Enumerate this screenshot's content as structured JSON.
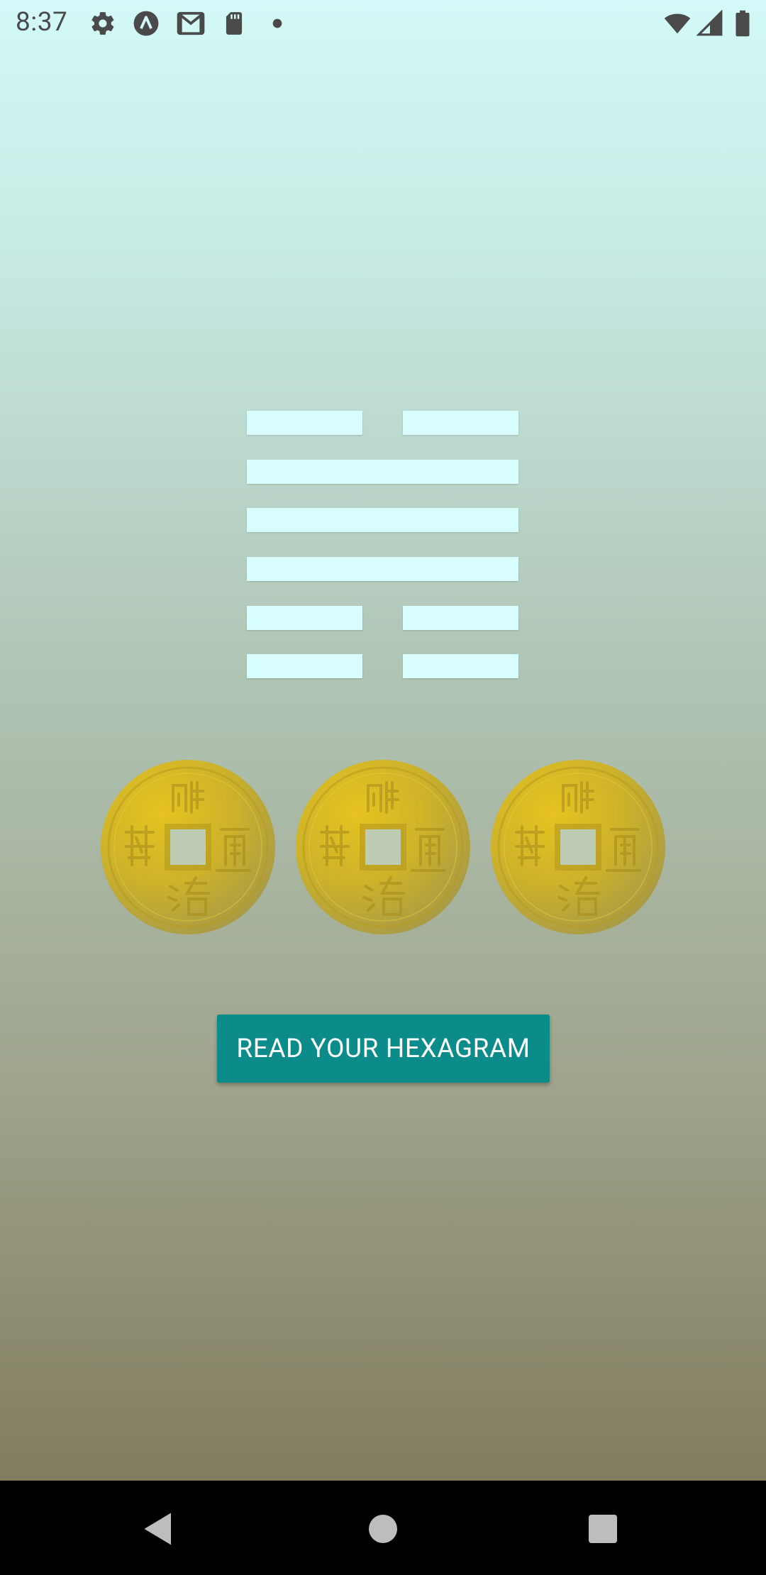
{
  "status_bar": {
    "time": "8:37",
    "left_icons": [
      "settings-icon",
      "a-circle-icon",
      "gmail-icon",
      "sd-card-icon",
      "dot-icon"
    ],
    "right_icons": [
      "wifi-icon",
      "signal-icon",
      "battery-icon"
    ]
  },
  "hexagram": {
    "lines_top_to_bottom": [
      "broken",
      "solid",
      "solid",
      "solid",
      "broken",
      "broken"
    ],
    "line_color": "#d8fefd"
  },
  "coins": {
    "count": 3,
    "icons": [
      "chinese-coin-icon",
      "chinese-coin-icon",
      "chinese-coin-icon"
    ]
  },
  "main": {
    "button_label": "READ YOUR HEXAGRAM",
    "button_color": "#0b8c8a"
  },
  "nav_bar": {
    "buttons": [
      "back-icon",
      "home-icon",
      "recents-icon"
    ]
  }
}
